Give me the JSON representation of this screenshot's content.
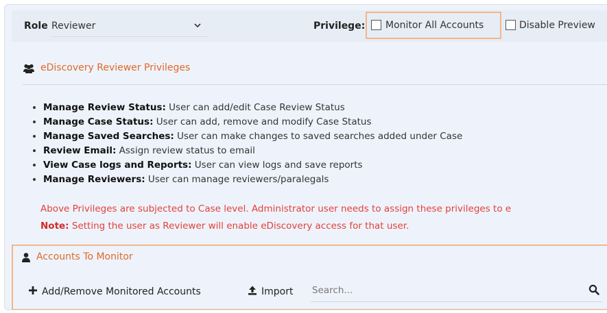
{
  "top_bar": {
    "role_label": "Role",
    "role_value": "Reviewer",
    "privilege_label": "Privilege:",
    "monitor_all_label": "Monitor All Accounts",
    "monitor_all_checked": false,
    "disable_preview_label": "Disable Preview",
    "disable_preview_checked": false
  },
  "privileges_section": {
    "title": "eDiscovery Reviewer Privileges",
    "items": [
      {
        "name": "Manage Review Status:",
        "desc": " User can add/edit Case Review Status"
      },
      {
        "name": "Manage Case Status:",
        "desc": " User can add, remove and modify Case Status"
      },
      {
        "name": "Manage Saved Searches:",
        "desc": " User can make changes to saved searches added under Case"
      },
      {
        "name": "Review Email:",
        "desc": " Assign review status to email"
      },
      {
        "name": "View Case logs and Reports:",
        "desc": " User can view logs and save reports"
      },
      {
        "name": "Manage Reviewers:",
        "desc": " User can manage reviewers/paralegals"
      }
    ],
    "notice": "Above Privileges are subjected to Case level. Administrator user needs to assign these privileges to e",
    "note_label": "Note:",
    "note_text": " Setting the user as Reviewer will enable eDiscovery access for that user."
  },
  "accounts_section": {
    "title": "Accounts To Monitor",
    "add_remove_label": "Add/Remove Monitored Accounts",
    "import_label": "Import",
    "search_placeholder": "Search..."
  },
  "colors": {
    "accent_orange": "#e0692a",
    "highlight_border": "#f3b58b",
    "warning_red": "#e4403a",
    "panel_bg": "#eef3fb"
  },
  "icons": {
    "section": "users-icon",
    "accounts": "user-icon",
    "add": "plus-icon",
    "import": "upload-icon",
    "search": "search-icon",
    "dropdown": "chevron-down-icon"
  }
}
